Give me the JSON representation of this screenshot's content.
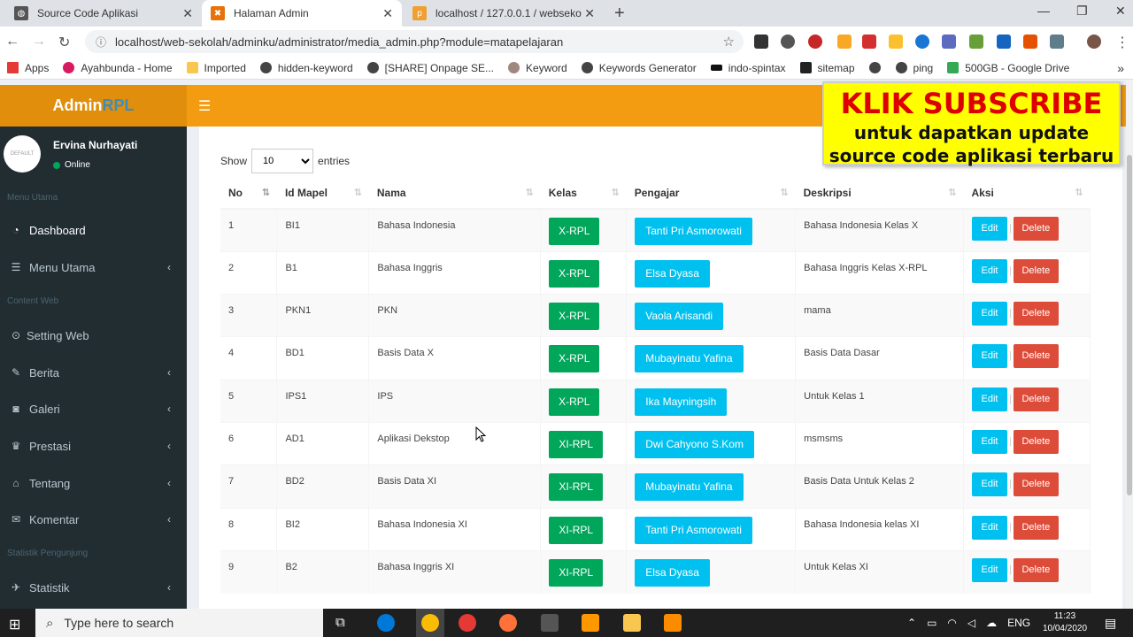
{
  "browser": {
    "tabs": [
      {
        "title": "Source Code Aplikasi",
        "active": false
      },
      {
        "title": "Halaman Admin",
        "active": true
      },
      {
        "title": "localhost / 127.0.0.1 / websekolah",
        "active": false
      }
    ],
    "new_tab": "+",
    "url": "localhost/web-sekolah/adminku/administrator/media_admin.php?module=matapelajaran",
    "bookmarks": [
      "Apps",
      "Ayahbunda - Home",
      "Imported",
      "hidden-keyword",
      "[SHARE] Onpage SE...",
      "Keyword",
      "Keywords Generator",
      "indo-spintax",
      "sitemap",
      "ping",
      "500GB - Google Drive"
    ]
  },
  "header": {
    "logo_main": "Admin",
    "logo_accent": "RPL",
    "menu_icon": "hamburger-icon"
  },
  "sidebar": {
    "user_name": "Ervina Nurhayati",
    "user_status": "Online",
    "avatar_text": "DEFAULT",
    "headers": [
      "Menu Utama",
      "Content Web",
      "Statistik Pengunjung"
    ],
    "items": [
      {
        "label": "Dashboard",
        "icon": "dashboard-icon",
        "glyph": "◔"
      },
      {
        "label": "Menu Utama",
        "icon": "list-icon",
        "glyph": "☰"
      },
      {
        "label": "Setting Web",
        "icon": "toggle-icon",
        "glyph": "⊙"
      },
      {
        "label": "Berita",
        "icon": "edit-icon",
        "glyph": "✎"
      },
      {
        "label": "Galeri",
        "icon": "camera-icon",
        "glyph": "◙"
      },
      {
        "label": "Prestasi",
        "icon": "trophy-icon",
        "glyph": "♛"
      },
      {
        "label": "Tentang",
        "icon": "home-icon",
        "glyph": "⌂"
      },
      {
        "label": "Komentar",
        "icon": "comments-icon",
        "glyph": "✉"
      },
      {
        "label": "Statistik",
        "icon": "plane-icon",
        "glyph": "✈"
      }
    ]
  },
  "table_controls": {
    "show_label": "Show",
    "page_length": "10",
    "entries_label": "entries"
  },
  "table": {
    "columns": [
      "No",
      "Id Mapel",
      "Nama",
      "Kelas",
      "Pengajar",
      "Deskripsi",
      "Aksi"
    ],
    "edit_label": "Edit",
    "delete_label": "Delete",
    "rows": [
      {
        "no": "1",
        "id": "BI1",
        "nama": "Bahasa Indonesia",
        "kelas": "X-RPL",
        "pengajar": "Tanti Pri Asmorowati",
        "deskripsi": "Bahasa Indonesia Kelas X"
      },
      {
        "no": "2",
        "id": "B1",
        "nama": "Bahasa Inggris",
        "kelas": "X-RPL",
        "pengajar": "Elsa Dyasa",
        "deskripsi": "Bahasa Inggris Kelas X-RPL"
      },
      {
        "no": "3",
        "id": "PKN1",
        "nama": "PKN",
        "kelas": "X-RPL",
        "pengajar": "Vaola Arisandi",
        "deskripsi": "mama"
      },
      {
        "no": "4",
        "id": "BD1",
        "nama": "Basis Data X",
        "kelas": "X-RPL",
        "pengajar": "Mubayinatu Yafina",
        "deskripsi": "Basis Data Dasar"
      },
      {
        "no": "5",
        "id": "IPS1",
        "nama": "IPS",
        "kelas": "X-RPL",
        "pengajar": "Ika Mayningsih",
        "deskripsi": "Untuk Kelas 1"
      },
      {
        "no": "6",
        "id": "AD1",
        "nama": "Aplikasi Dekstop",
        "kelas": "XI-RPL",
        "pengajar": "Dwi Cahyono S.Kom",
        "deskripsi": "msmsms"
      },
      {
        "no": "7",
        "id": "BD2",
        "nama": "Basis Data XI",
        "kelas": "XI-RPL",
        "pengajar": "Mubayinatu Yafina",
        "deskripsi": "Basis Data Untuk Kelas 2"
      },
      {
        "no": "8",
        "id": "BI2",
        "nama": "Bahasa Indonesia XI",
        "kelas": "XI-RPL",
        "pengajar": "Tanti Pri Asmorowati",
        "deskripsi": "Bahasa Indonesia kelas XI"
      },
      {
        "no": "9",
        "id": "B2",
        "nama": "Bahasa Inggris XI",
        "kelas": "XI-RPL",
        "pengajar": "Elsa Dyasa",
        "deskripsi": "Untuk Kelas XI"
      }
    ]
  },
  "banner": {
    "line1": "KLIK SUBSCRIBE",
    "line2": "untuk dapatkan update",
    "line3": "source code aplikasi terbaru"
  },
  "taskbar": {
    "search_placeholder": "Type here to search",
    "language": "ENG",
    "time": "11:23",
    "date": "10/04/2020"
  },
  "colors": {
    "header_orange": "#f39c12",
    "logo_orange": "#e08e0b",
    "sidebar_dark": "#222d32",
    "class_green": "#00a65a",
    "teacher_cyan": "#00c0ef",
    "delete_red": "#dd4b39",
    "banner_yellow": "#ffff00"
  }
}
